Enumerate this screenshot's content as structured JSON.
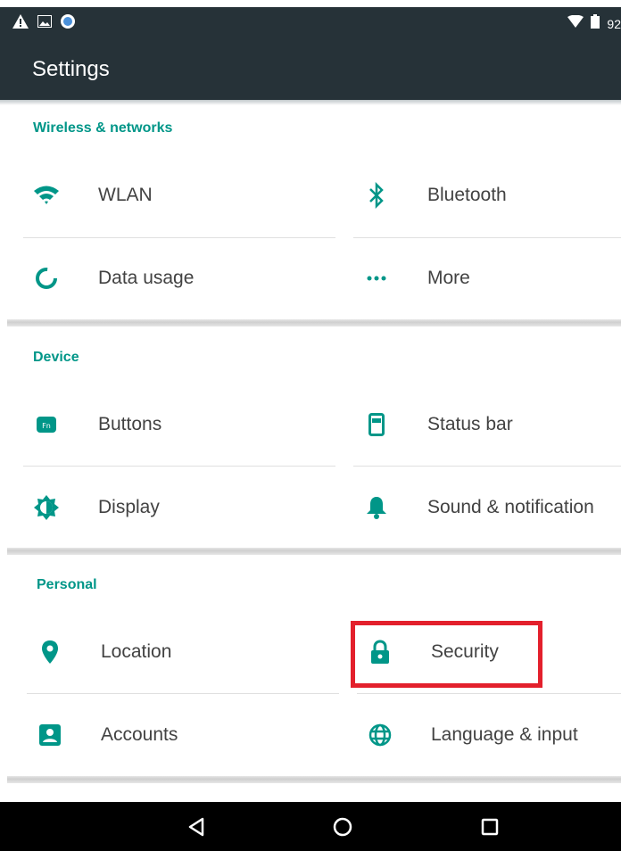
{
  "status_bar": {
    "icons_left": [
      "warning-icon",
      "image-icon",
      "app-icon"
    ],
    "icons_right": [
      "wifi-icon",
      "battery-icon"
    ],
    "battery_text": "92"
  },
  "action_bar": {
    "title": "Settings"
  },
  "sections": {
    "wireless": {
      "header": "Wireless & networks",
      "wlan": "WLAN",
      "bluetooth": "Bluetooth",
      "data_usage": "Data usage",
      "more": "More"
    },
    "device": {
      "header": "Device",
      "buttons": "Buttons",
      "status_bar": "Status bar",
      "display": "Display",
      "sound": "Sound & notification"
    },
    "personal": {
      "header": "Personal",
      "location": "Location",
      "security": "Security",
      "accounts": "Accounts",
      "language": "Language & input"
    }
  },
  "colors": {
    "accent": "#009688",
    "appbar": "#263238",
    "highlight": "#e3202c"
  },
  "nav_bar": [
    "back-icon",
    "home-icon",
    "recents-icon"
  ]
}
